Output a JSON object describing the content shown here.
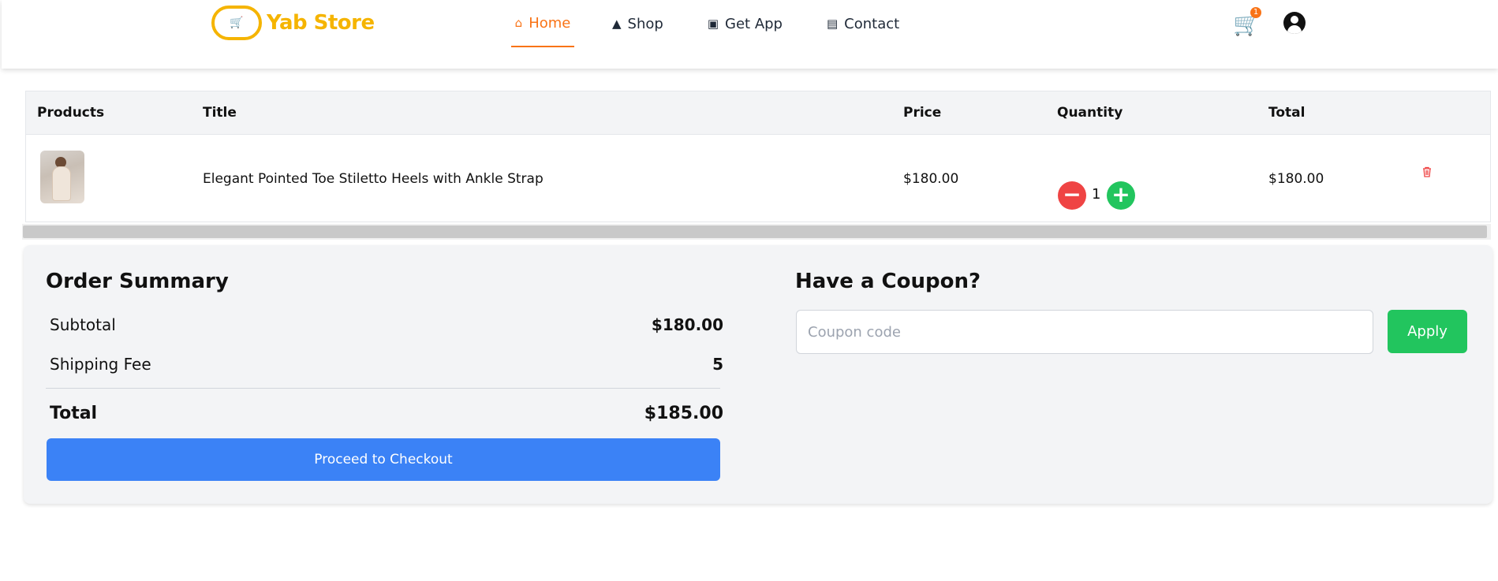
{
  "header": {
    "logo_text": "Yab Store",
    "logo_icon": "cart-logo-icon",
    "nav": [
      {
        "label": "Home",
        "icon": "home-icon",
        "active": true
      },
      {
        "label": "Shop",
        "icon": "shapes-icon",
        "active": false
      },
      {
        "label": "Get App",
        "icon": "app-icon",
        "active": false
      },
      {
        "label": "Contact",
        "icon": "contact-icon",
        "active": false
      }
    ],
    "cart_count": "1",
    "accent_color": "#f97316",
    "brand_color": "#f5b400"
  },
  "table": {
    "headers": [
      "Products",
      "Title",
      "Price",
      "Quantity",
      "Total"
    ],
    "rows": [
      {
        "title": "Elegant Pointed Toe Stiletto Heels with Ankle Strap",
        "price": "$180.00",
        "quantity": "1",
        "total": "$180.00"
      }
    ]
  },
  "summary": {
    "title": "Order Summary",
    "subtotal_label": "Subtotal",
    "subtotal_value": "$180.00",
    "shipping_label": "Shipping Fee",
    "shipping_value": "5",
    "total_label": "Total",
    "total_value": "$185.00",
    "checkout_label": "Proceed to Checkout"
  },
  "coupon": {
    "title": "Have a Coupon?",
    "placeholder": "Coupon code",
    "apply_label": "Apply"
  }
}
